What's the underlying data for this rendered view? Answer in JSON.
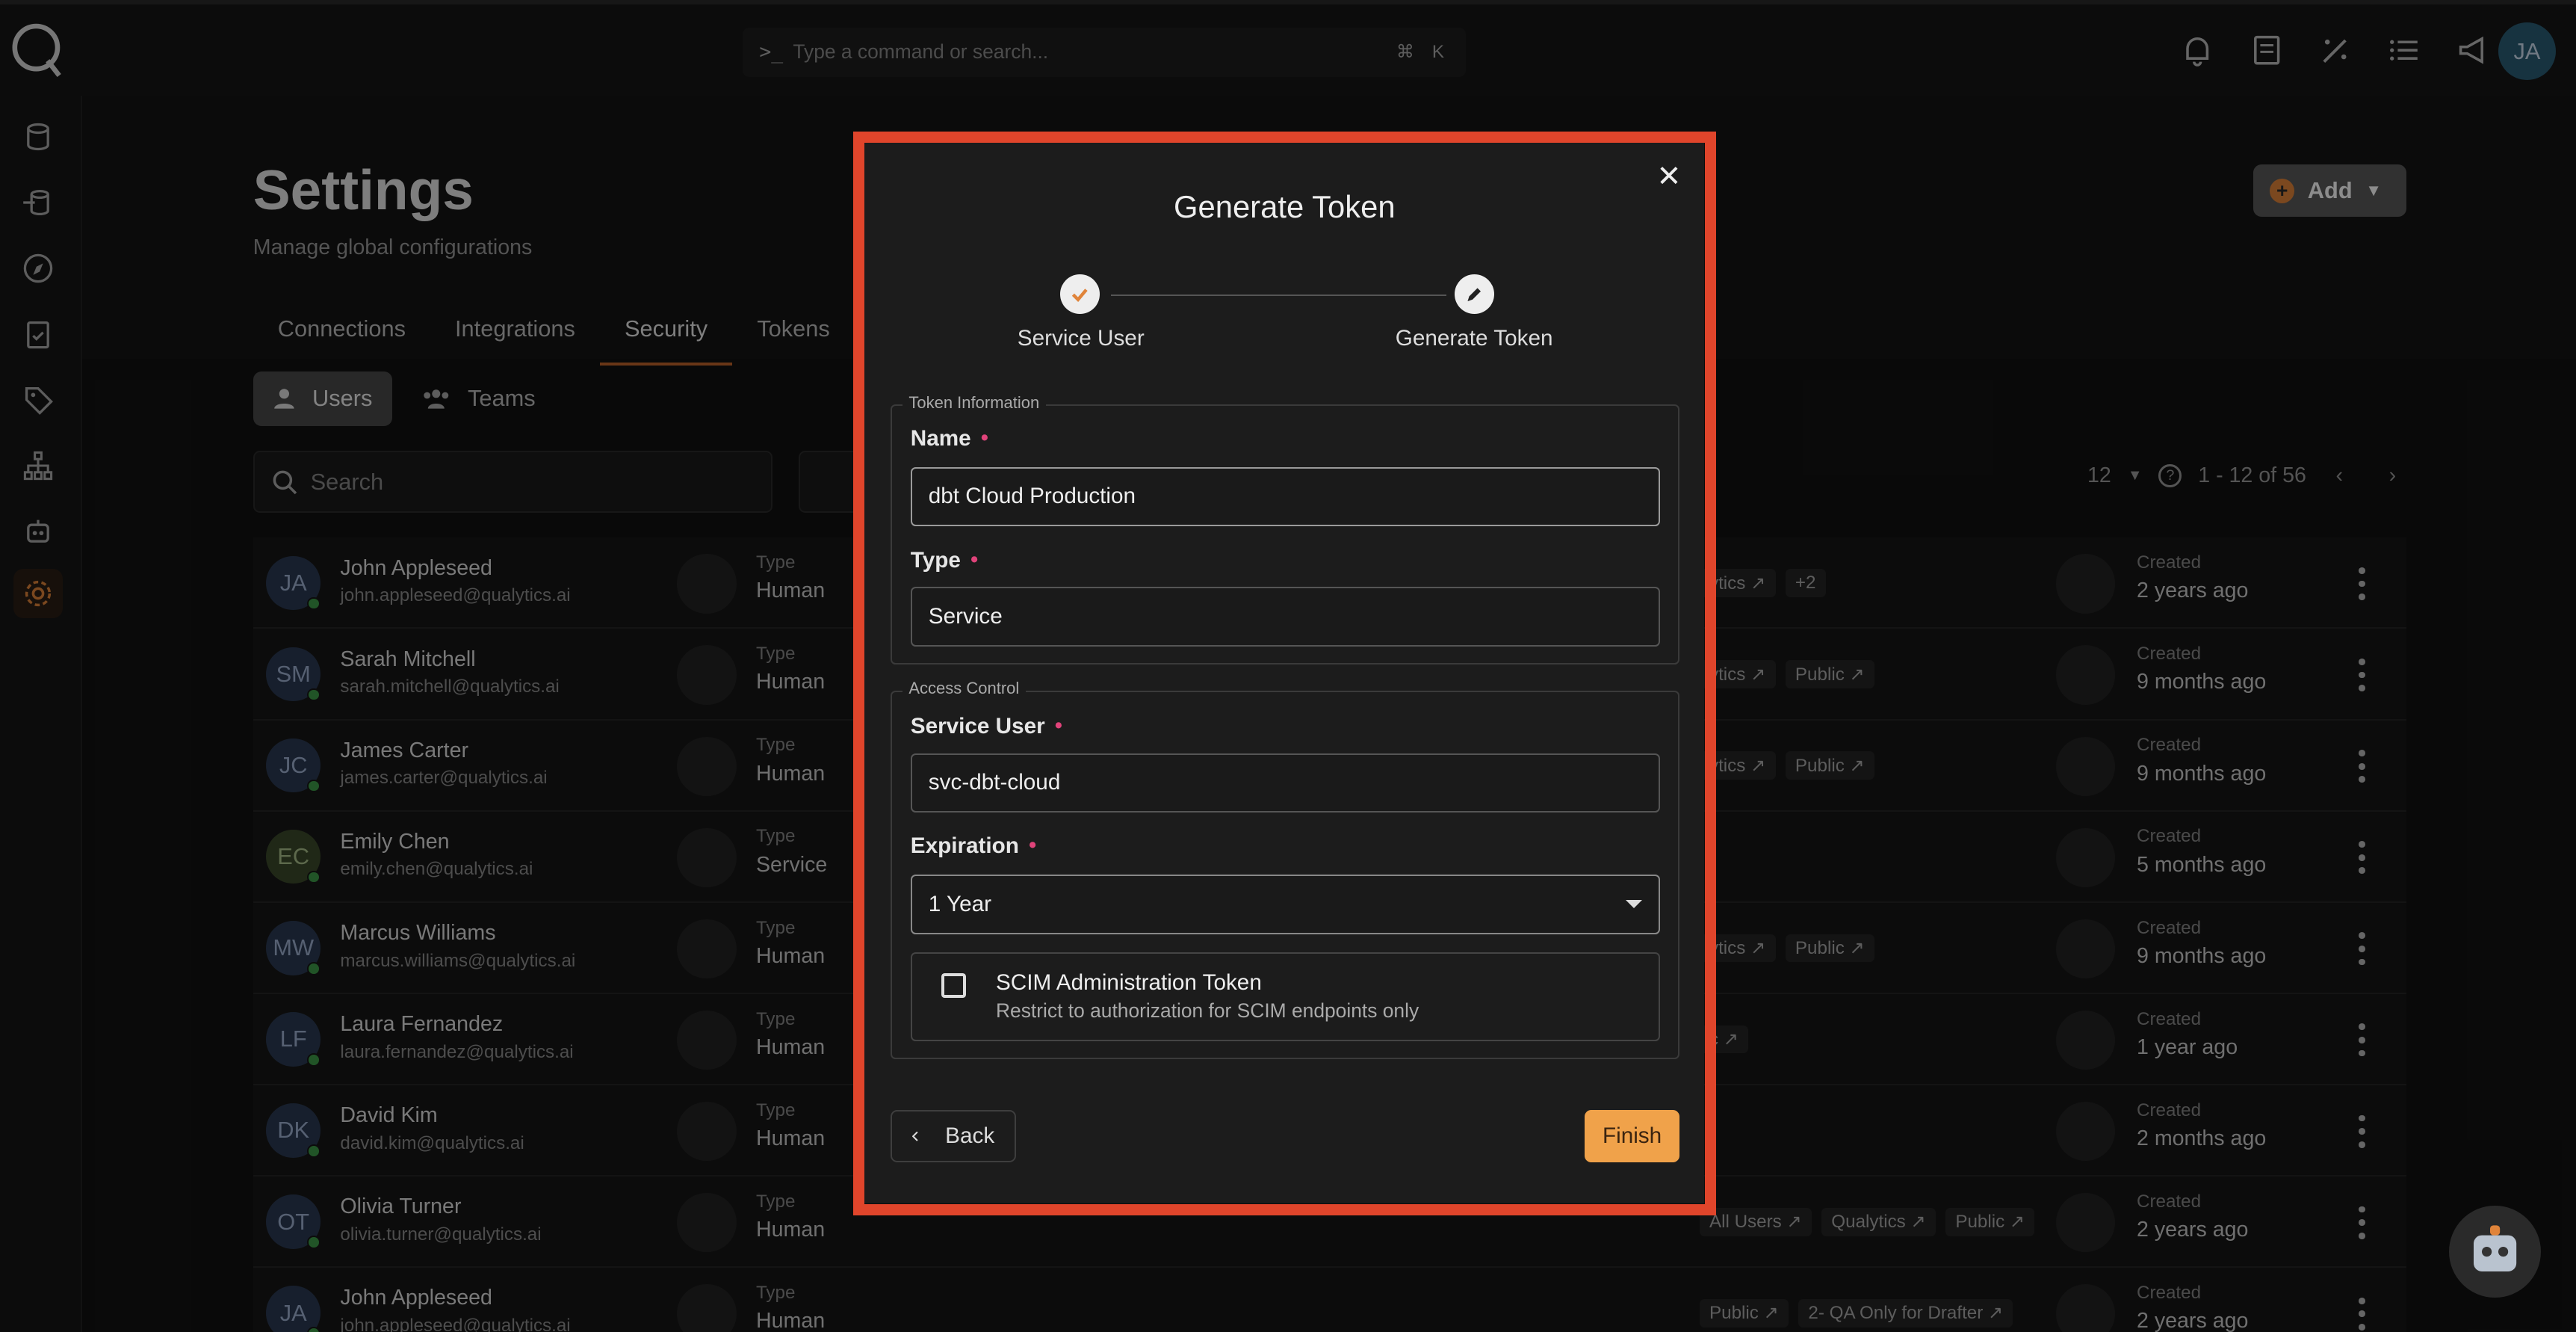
{
  "command_bar": {
    "placeholder": "Type a command or search...",
    "key1": "⌘",
    "key2": "K"
  },
  "user": {
    "initials": "JA"
  },
  "page": {
    "title": "Settings",
    "subtitle": "Manage global configurations",
    "add_label": "Add",
    "tabs": [
      "Connections",
      "Integrations",
      "Security",
      "Tokens"
    ],
    "active_tab": "Security",
    "toggles": [
      "Users",
      "Teams"
    ],
    "search_placeholder": "Search",
    "page_size": "12",
    "range": "1 - 12 of 56"
  },
  "rows": [
    {
      "initials": "JA",
      "name": "John Appleseed",
      "email": "john.appleseed@qualytics.ai",
      "type_label": "Type",
      "type": "Human",
      "tags": [
        "ytics ↗",
        "+2"
      ],
      "created_label": "Created",
      "created": "2 years ago"
    },
    {
      "initials": "SM",
      "name": "Sarah Mitchell",
      "email": "sarah.mitchell@qualytics.ai",
      "type_label": "Type",
      "type": "Human",
      "tags": [
        "ytics ↗",
        "Public ↗"
      ],
      "created_label": "Created",
      "created": "9 months ago"
    },
    {
      "initials": "JC",
      "name": "James Carter",
      "email": "james.carter@qualytics.ai",
      "type_label": "Type",
      "type": "Human",
      "tags": [
        "ytics ↗",
        "Public ↗"
      ],
      "created_label": "Created",
      "created": "9 months ago"
    },
    {
      "initials": "EC",
      "name": "Emily Chen",
      "email": "emily.chen@qualytics.ai",
      "type_label": "Type",
      "type": "Service",
      "tags": [],
      "created_label": "Created",
      "created": "5 months ago"
    },
    {
      "initials": "MW",
      "name": "Marcus Williams",
      "email": "marcus.williams@qualytics.ai",
      "type_label": "Type",
      "type": "Human",
      "tags": [
        "ytics ↗",
        "Public ↗"
      ],
      "created_label": "Created",
      "created": "9 months ago"
    },
    {
      "initials": "LF",
      "name": "Laura Fernandez",
      "email": "laura.fernandez@qualytics.ai",
      "type_label": "Type",
      "type": "Human",
      "tags": [
        "c ↗"
      ],
      "created_label": "Created",
      "created": "1 year ago"
    },
    {
      "initials": "DK",
      "name": "David Kim",
      "email": "david.kim@qualytics.ai",
      "type_label": "Type",
      "type": "Human",
      "tags": [],
      "created_label": "Created",
      "created": "2 months ago"
    },
    {
      "initials": "OT",
      "name": "Olivia Turner",
      "email": "olivia.turner@qualytics.ai",
      "type_label": "Type",
      "type": "Human",
      "tags": [
        "All Users ↗",
        "Qualytics ↗",
        "Public ↗"
      ],
      "created_label": "Created",
      "created": "2 years ago"
    },
    {
      "initials": "JA",
      "name": "John Appleseed",
      "email": "john.appleseed@qualytics.ai",
      "type_label": "Type",
      "type": "Human",
      "tags": [
        "Public ↗",
        "2- QA Only for Drafter ↗"
      ],
      "created_label": "Created",
      "created": "2 years ago"
    }
  ],
  "modal": {
    "title": "Generate Token",
    "step1_label": "Service User",
    "step2_label": "Generate Token",
    "section1_legend": "Token Information",
    "name_label": "Name",
    "name_value": "dbt Cloud Production",
    "type_label": "Type",
    "type_value": "Service",
    "section2_legend": "Access Control",
    "service_user_label": "Service User",
    "service_user_value": "svc-dbt-cloud",
    "expiration_label": "Expiration",
    "expiration_value": "1 Year",
    "scim_title": "SCIM Administration Token",
    "scim_desc": "Restrict to authorization for SCIM endpoints only",
    "back_label": "Back",
    "finish_label": "Finish",
    "required_mark": "•"
  },
  "colors": {
    "accent": "#f0a24a",
    "highlight_frame": "#e0452b",
    "required": "#e0437a"
  }
}
